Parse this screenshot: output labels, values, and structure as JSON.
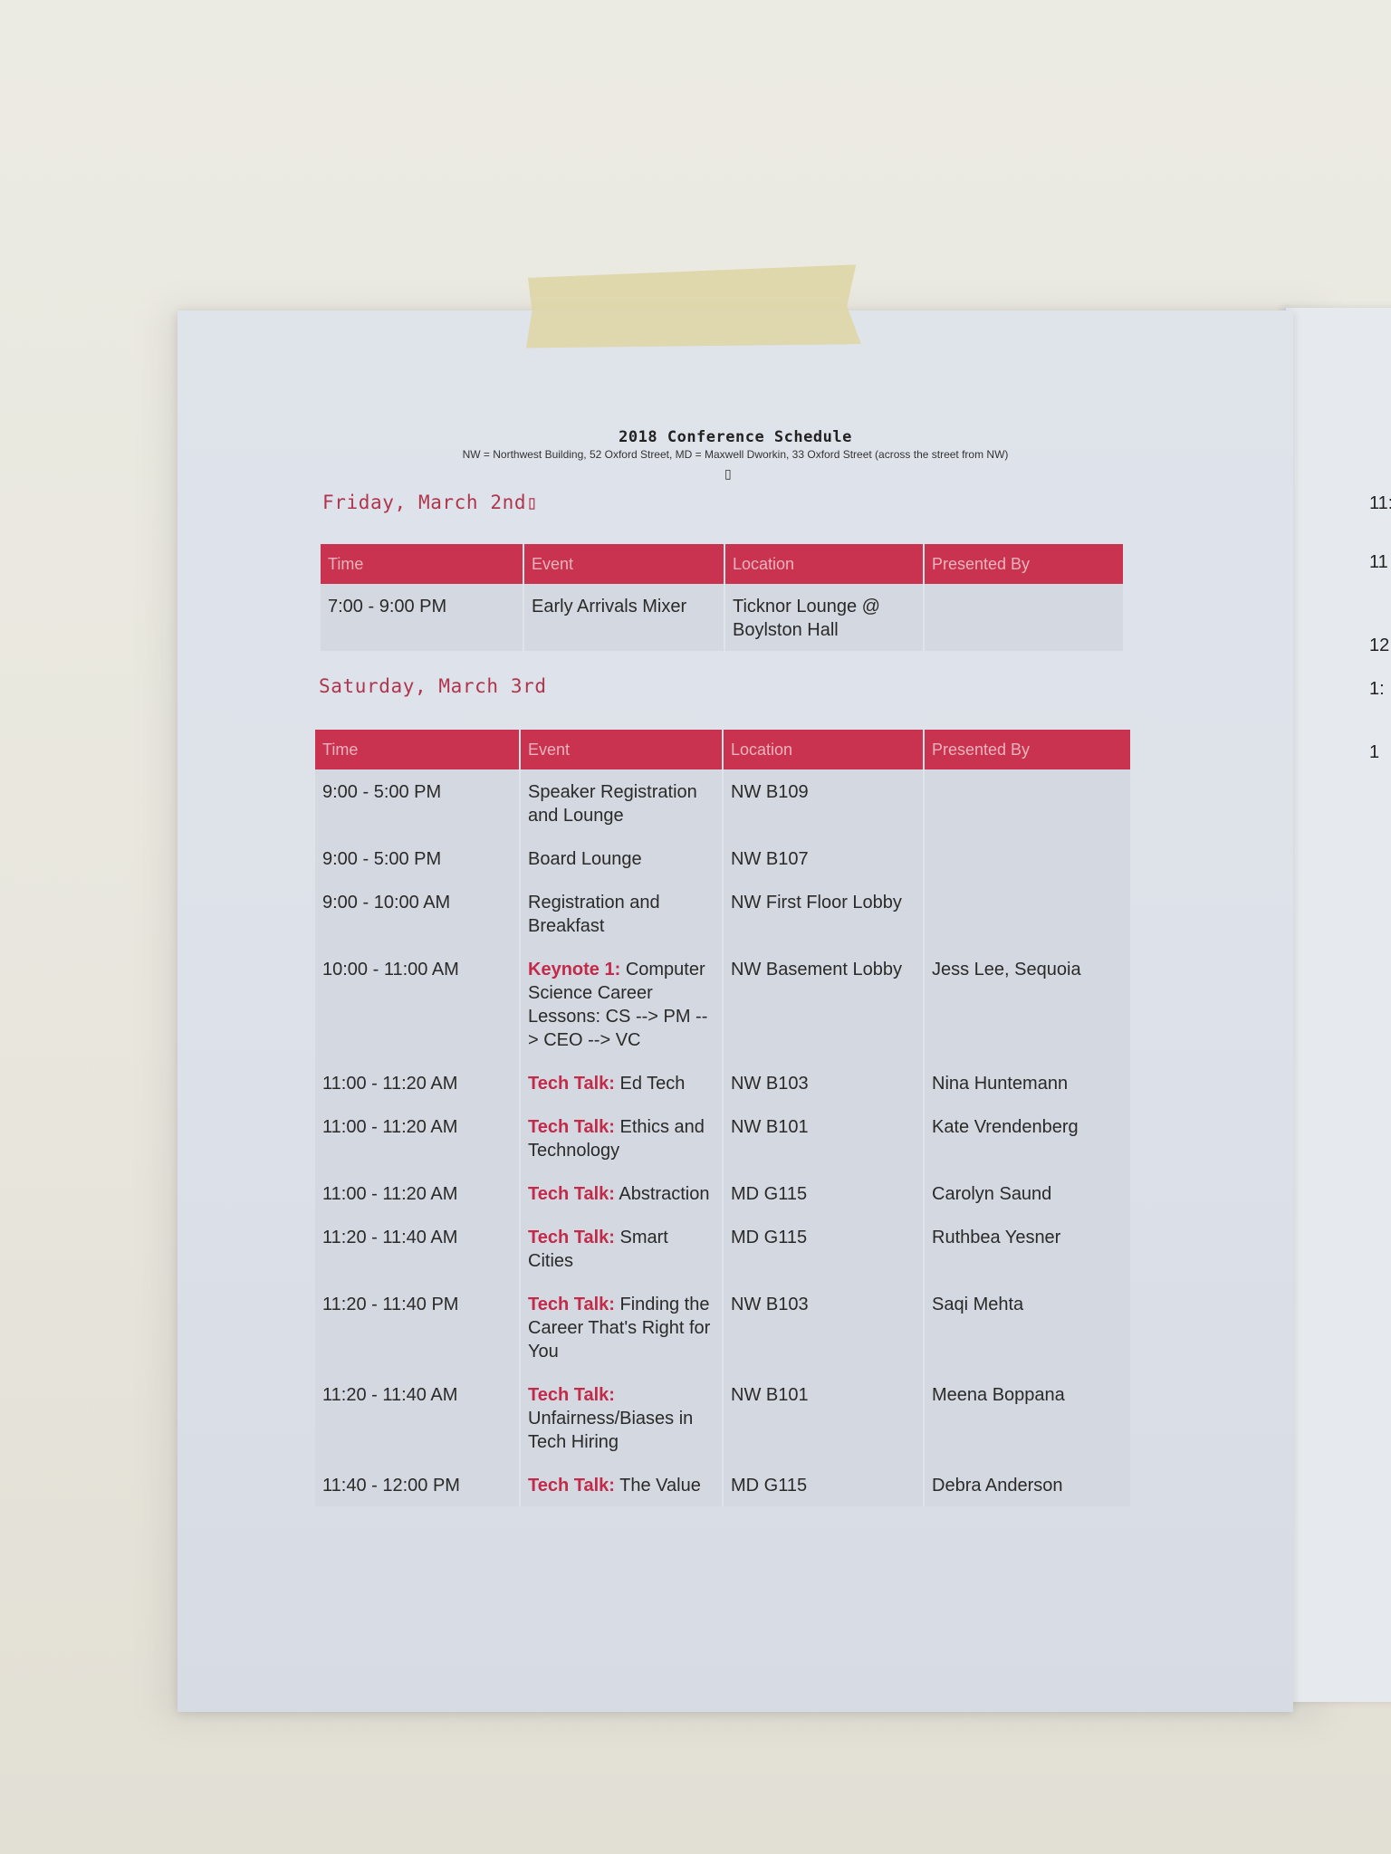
{
  "document": {
    "title": "2018 Conference Schedule",
    "subtitle": "NW = Northwest Building, 52 Oxford Street, MD = Maxwell Dworkin, 33 Oxford Street (across the street from NW)",
    "mark": "▯"
  },
  "colors": {
    "header_bg": "#c9334f",
    "header_text": "#eab3bd",
    "accent_red": "#c32a49",
    "cell_bg": "#d4d8e0",
    "paper": "#dfe3ea",
    "tape": "#ded6a8"
  },
  "days": [
    {
      "heading": "Friday, March 2nd▯",
      "columns": [
        "Time",
        "Event",
        "Location",
        "Presented By"
      ],
      "rows": [
        {
          "time": "7:00 - 9:00 PM",
          "label": "",
          "event": "Early Arrivals Mixer",
          "location": "Ticknor Lounge @ Boylston Hall",
          "presenter": ""
        }
      ]
    },
    {
      "heading": "Saturday, March 3rd",
      "columns": [
        "Time",
        "Event",
        "Location",
        "Presented By"
      ],
      "rows": [
        {
          "time": "9:00 - 5:00 PM",
          "label": "",
          "event": "Speaker Registration and Lounge",
          "location": "NW B109",
          "presenter": ""
        },
        {
          "time": "9:00 - 5:00 PM",
          "label": "",
          "event": "Board Lounge",
          "location": "NW B107",
          "presenter": ""
        },
        {
          "time": "9:00 - 10:00 AM",
          "label": "",
          "event": "Registration and Breakfast",
          "location": "NW First Floor Lobby",
          "presenter": ""
        },
        {
          "time": "10:00 - 11:00 AM",
          "label": "Keynote 1:",
          "event": "Computer Science Career Lessons: CS --> PM --> CEO --> VC",
          "location": "NW Basement Lobby",
          "presenter": "Jess Lee, Sequoia"
        },
        {
          "time": "11:00 - 11:20 AM",
          "label": "Tech Talk:",
          "event": "Ed Tech",
          "location": "NW B103",
          "presenter": "Nina Huntemann"
        },
        {
          "time": "11:00 - 11:20 AM",
          "label": "Tech Talk:",
          "event": "Ethics and Technology",
          "location": "NW B101",
          "presenter": "Kate Vrendenberg"
        },
        {
          "time": "11:00 - 11:20 AM",
          "label": "Tech Talk:",
          "event": "Abstraction",
          "location": "MD G115",
          "presenter": "Carolyn Saund"
        },
        {
          "time": "11:20 - 11:40 AM",
          "label": "Tech Talk:",
          "event": "Smart Cities",
          "location": "MD G115",
          "presenter": "Ruthbea Yesner"
        },
        {
          "time": "11:20 - 11:40 PM",
          "label": "Tech Talk:",
          "event": "Finding the Career That's Right for You",
          "location": "NW B103",
          "presenter": "Saqi Mehta"
        },
        {
          "time": "11:20 - 11:40 AM",
          "label": "Tech Talk:",
          "event": "Unfairness/Biases in Tech Hiring",
          "location": "NW B101",
          "presenter": "Meena Boppana"
        },
        {
          "time": "11:40 - 12:00 PM",
          "label": "Tech Talk:",
          "event": "The Value",
          "location": "MD G115",
          "presenter": "Debra Anderson"
        }
      ]
    }
  ],
  "adjacent_sheet": {
    "fragments": [
      "11:",
      "11",
      "12",
      "1:",
      "1"
    ]
  }
}
